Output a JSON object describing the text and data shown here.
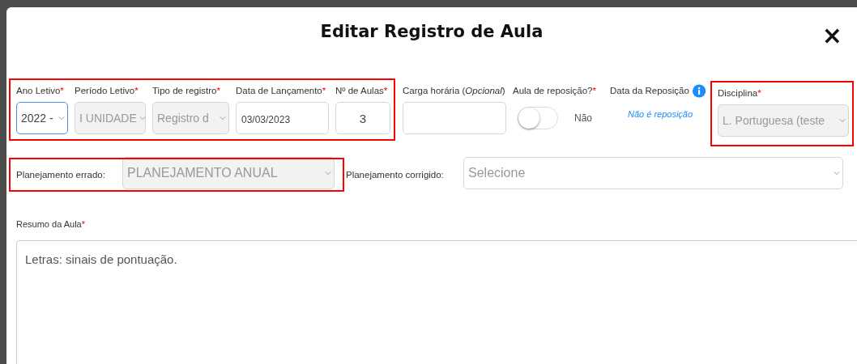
{
  "required_mark": "*",
  "modal": {
    "title": "Editar Registro de Aula",
    "close": "×"
  },
  "row_1": [
    {
      "highlighted": true,
      "fields": [
        {
          "kind": "select",
          "label": "Ano Letivo",
          "required": true,
          "value": "2022 -",
          "disabled": false,
          "focused": true
        },
        {
          "kind": "select",
          "label": "Período Letivo",
          "required": true,
          "value": "I UNIDADE",
          "disabled": true,
          "focused": false
        },
        {
          "kind": "select",
          "label": "Tipo de registro",
          "required": true,
          "value": "Registro d",
          "disabled": true,
          "focused": false
        },
        {
          "kind": "text",
          "label": "Data de Lançamento",
          "required": true,
          "value": "03/03/2023",
          "disabled": false,
          "focused": false
        },
        {
          "kind": "number",
          "label": "Nº de Aulas",
          "required": true,
          "value": "3",
          "disabled": false,
          "focused": false
        }
      ]
    },
    {
      "highlighted": false,
      "fields": [
        {
          "kind": "text",
          "label": "Carga horária (*Opcional*)",
          "required": false,
          "disabled": false,
          "focused": false
        },
        {
          "kind": "toggle",
          "label": "Aula de reposição?",
          "required": true,
          "on": false,
          "value": "Não"
        },
        {
          "kind": "note",
          "label": "Data da Reposição",
          "required": false,
          "info": true,
          "value": "Não é reposição"
        }
      ]
    },
    {
      "highlighted": true,
      "fields": [
        {
          "kind": "select",
          "label": "Disciplina",
          "required": true,
          "value": "L. Portuguesa (teste",
          "disabled": true,
          "focused": false
        }
      ]
    }
  ],
  "row_2": [
    {
      "highlighted": true,
      "label": "Planejamento errado:",
      "value": "PLANEJAMENTO ANUAL",
      "disabled": true
    },
    {
      "highlighted": false,
      "label": "Planejamento corrigido:",
      "placeholder": "Selecione",
      "disabled": false
    }
  ],
  "summary": {
    "label": "Resumo da Aula",
    "required": true,
    "value": "Letras: sinais de pontuação."
  }
}
